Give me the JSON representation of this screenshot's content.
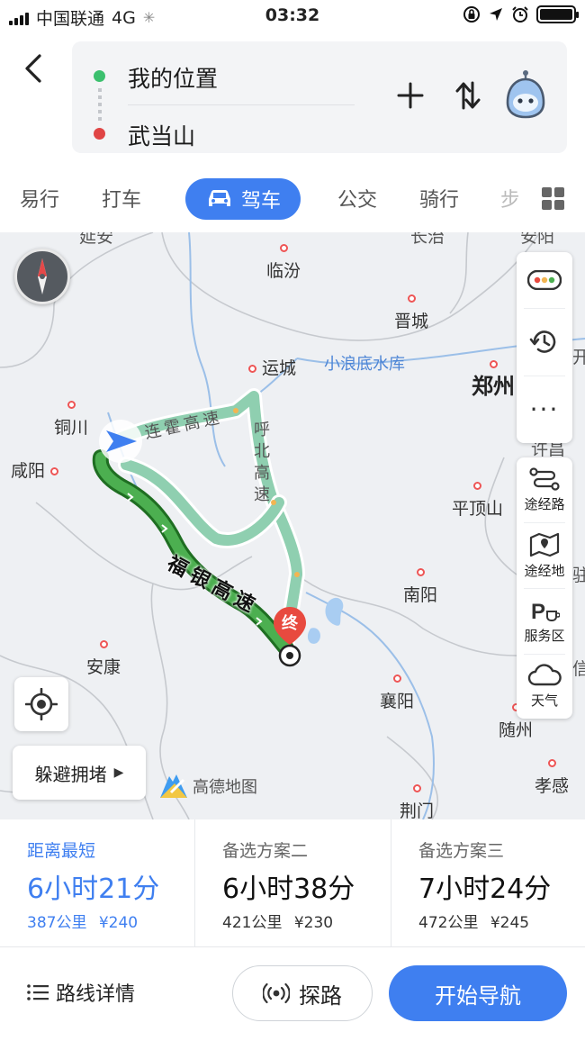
{
  "status_bar": {
    "carrier": "中国联通",
    "network": "4G",
    "time": "03:32"
  },
  "route": {
    "start": "我的位置",
    "destination": "武当山"
  },
  "modes": {
    "items": [
      "易行",
      "打车",
      "驾车",
      "公交",
      "骑行",
      "步"
    ],
    "active": "驾车"
  },
  "map": {
    "cities": {
      "linfen": "临汾",
      "jincheng": "晋城",
      "yuncheng": "运城",
      "zhengzhou": "郑州",
      "tongchuan": "铜川",
      "xianyang": "咸阳",
      "pingdingshan": "平顶山",
      "nanyang": "南阳",
      "ankang": "安康",
      "xiangyang": "襄阳",
      "suizhou": "随州",
      "xiaogan": "孝感",
      "jingmen": "荆门",
      "edge_top_left": "延安",
      "edge_top_mid": "长治",
      "edge_top_right": "安阳",
      "edge_right_1": "开封",
      "edge_right_2": "许昌",
      "edge_right_3": "驻马店",
      "edge_right_4": "信阳"
    },
    "lake": "小浪底水库",
    "highways": {
      "lianhuo": "连霍高速",
      "hubei": "呼北高速",
      "fuyin": "福银高速"
    },
    "end_marker": "终",
    "side_tools": {
      "waypoint_route": "途经路",
      "waypoint_place": "途经地",
      "service_area": "服务区",
      "weather": "天气"
    },
    "avoid_button": "躲避拥堵",
    "brand": "高德地图"
  },
  "options": [
    {
      "name": "距离最短",
      "duration": "6小时21分",
      "distance": "387公里",
      "toll": "¥240",
      "selected": true
    },
    {
      "name": "备选方案二",
      "duration": "6小时38分",
      "distance": "421公里",
      "toll": "¥230",
      "selected": false
    },
    {
      "name": "备选方案三",
      "duration": "7小时24分",
      "distance": "472公里",
      "toll": "¥245",
      "selected": false
    }
  ],
  "actions": {
    "details": "路线详情",
    "explore": "探路",
    "start_navigation": "开始导航"
  },
  "colors": {
    "accent": "#3f7ff0",
    "main_route": "#3a9c3e",
    "alt_route": "#8fcfb0",
    "start_dot": "#3cc06e",
    "end_dot": "#e04545",
    "end_marker": "#e84a3f"
  }
}
